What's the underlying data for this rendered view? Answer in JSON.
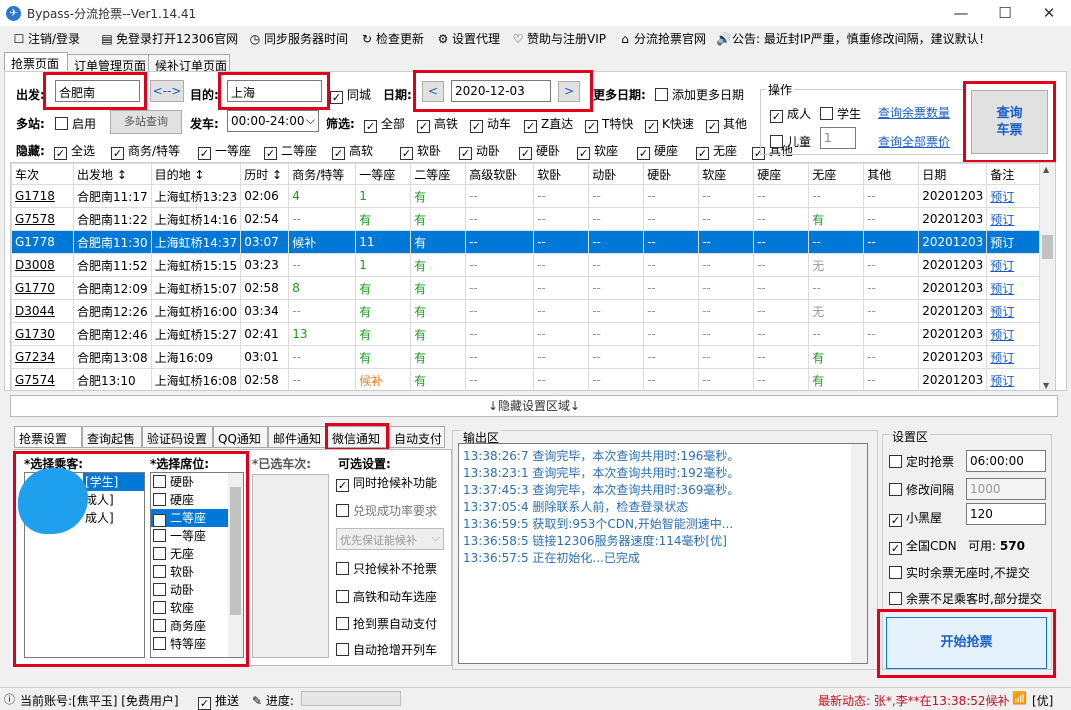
{
  "window": {
    "title": "Bypass-分流抢票--Ver1.14.41",
    "min": "—",
    "max": "☐",
    "close": "✕"
  },
  "menu": [
    {
      "icon": "☐",
      "label": "注销/登录"
    },
    {
      "icon": "▤",
      "label": "免登录打开12306官网"
    },
    {
      "icon": "◷",
      "label": "同步服务器时间"
    },
    {
      "icon": "↻",
      "label": "检查更新"
    },
    {
      "icon": "⚙",
      "label": "设置代理"
    },
    {
      "icon": "♡",
      "label": "赞助与注册VIP"
    },
    {
      "icon": "⌂",
      "label": "分流抢票官网"
    },
    {
      "icon": "🔊",
      "label": "公告: 最近封IP严重，慎重修改间隔，建议默认！"
    }
  ],
  "tabs": [
    "抢票页面",
    "订单管理页面",
    "候补订单页面"
  ],
  "query": {
    "from_label": "出发:",
    "from": "合肥南",
    "swap": "<-->",
    "to_label": "目的:",
    "to": "上海",
    "same_city": "同城",
    "date_label": "日期:",
    "date": "2020-12-03",
    "prev": "<",
    "next": ">",
    "more_dates_label": "更多日期:",
    "add_more_dates": "添加更多日期",
    "multi_label": "多站:",
    "enable": "启用",
    "multi_query": "多站查询",
    "depart_label": "发车:",
    "depart_time": "00:00-24:00",
    "filter_label": "筛选:",
    "filters": [
      {
        "label": "全部",
        "checked": true
      },
      {
        "label": "高铁",
        "checked": true
      },
      {
        "label": "动车",
        "checked": true
      },
      {
        "label": "Z直达",
        "checked": true
      },
      {
        "label": "T特快",
        "checked": true
      },
      {
        "label": "K快速",
        "checked": true
      },
      {
        "label": "其他",
        "checked": true
      }
    ],
    "hide_label": "隐藏:",
    "hides": [
      {
        "label": "全选",
        "checked": true
      },
      {
        "label": "商务/特等",
        "checked": true
      },
      {
        "label": "一等座",
        "checked": true
      },
      {
        "label": "二等座",
        "checked": true
      },
      {
        "label": "高软",
        "checked": true
      },
      {
        "label": "软卧",
        "checked": true
      },
      {
        "label": "动卧",
        "checked": true
      },
      {
        "label": "硬卧",
        "checked": true
      },
      {
        "label": "软座",
        "checked": true
      },
      {
        "label": "硬座",
        "checked": true
      },
      {
        "label": "无座",
        "checked": true
      },
      {
        "label": "其他",
        "checked": true
      }
    ]
  },
  "ops": {
    "title": "操作",
    "adult": "成人",
    "student": "学生",
    "child": "儿童",
    "child_count": "1",
    "query_remain": "查询余票数量",
    "query_prices": "查询全部票价",
    "query_btn": "查询\n车票"
  },
  "table": {
    "headers": [
      "车次",
      "出发地 ↕",
      "目的地 ↕",
      "历时 ↕",
      "商务/特等",
      "一等座",
      "二等座",
      "高级软卧",
      "软卧",
      "动卧",
      "硬卧",
      "软座",
      "硬座",
      "无座",
      "其他",
      "日期",
      "备注"
    ],
    "rows": [
      [
        "G1718",
        "合肥南11:17",
        "上海虹桥13:23",
        "02:06",
        "4",
        "1",
        "有",
        "--",
        "--",
        "--",
        "--",
        "--",
        "--",
        "--",
        "--",
        "20201203",
        "预订"
      ],
      [
        "G7578",
        "合肥南11:22",
        "上海虹桥14:16",
        "02:54",
        "--",
        "有",
        "有",
        "--",
        "--",
        "--",
        "--",
        "--",
        "--",
        "有",
        "--",
        "20201203",
        "预订"
      ],
      [
        "G1778",
        "合肥南11:30",
        "上海虹桥14:37",
        "03:07",
        "候补",
        "11",
        "有",
        "--",
        "--",
        "--",
        "--",
        "--",
        "--",
        "--",
        "--",
        "20201203",
        "预订"
      ],
      [
        "D3008",
        "合肥南11:52",
        "上海虹桥15:15",
        "03:23",
        "--",
        "1",
        "有",
        "--",
        "--",
        "--",
        "--",
        "--",
        "--",
        "无",
        "--",
        "20201203",
        "预订"
      ],
      [
        "G1770",
        "合肥南12:09",
        "上海虹桥15:07",
        "02:58",
        "8",
        "有",
        "有",
        "--",
        "--",
        "--",
        "--",
        "--",
        "--",
        "--",
        "--",
        "20201203",
        "预订"
      ],
      [
        "D3044",
        "合肥南12:26",
        "上海虹桥16:00",
        "03:34",
        "--",
        "有",
        "有",
        "--",
        "--",
        "--",
        "--",
        "--",
        "--",
        "无",
        "--",
        "20201203",
        "预订"
      ],
      [
        "G1730",
        "合肥南12:46",
        "上海虹桥15:27",
        "02:41",
        "13",
        "有",
        "有",
        "--",
        "--",
        "--",
        "--",
        "--",
        "--",
        "--",
        "--",
        "20201203",
        "预订"
      ],
      [
        "G7234",
        "合肥南13:08",
        "上海16:09",
        "03:01",
        "--",
        "有",
        "有",
        "--",
        "--",
        "--",
        "--",
        "--",
        "--",
        "有",
        "--",
        "20201203",
        "预订"
      ],
      [
        "G7574",
        "合肥13:10",
        "上海虹桥16:08",
        "02:58",
        "--",
        "候补",
        "有",
        "--",
        "--",
        "--",
        "--",
        "--",
        "--",
        "有",
        "--",
        "20201203",
        "预订"
      ]
    ]
  },
  "hide_area": "↓隐藏设置区域↓",
  "tabs2": [
    "抢票设置",
    "查询起售",
    "验证码设置",
    "QQ通知",
    "邮件通知",
    "微信通知",
    "自动支付"
  ],
  "settings": {
    "passengers_label": "*选择乘客:",
    "passengers": [
      "[学生]",
      "成人]",
      "成人]"
    ],
    "seats_label": "*选择席位:",
    "seats": [
      {
        "label": "硬卧",
        "checked": false
      },
      {
        "label": "硬座",
        "checked": false
      },
      {
        "label": "二等座",
        "checked": true
      },
      {
        "label": "一等座",
        "checked": false
      },
      {
        "label": "无座",
        "checked": false
      },
      {
        "label": "软卧",
        "checked": false
      },
      {
        "label": "动卧",
        "checked": false
      },
      {
        "label": "软座",
        "checked": false
      },
      {
        "label": "商务座",
        "checked": false
      },
      {
        "label": "特等座",
        "checked": false
      }
    ],
    "trains_label": "*已选车次:",
    "options_label": "可选设置:",
    "options": [
      {
        "label": "同时抢候补功能",
        "checked": true
      },
      {
        "label": "兑现成功率要求",
        "checked": false
      },
      {
        "label": "只抢候补不抢票",
        "checked": false
      },
      {
        "label": "高铁和动车选座",
        "checked": false
      },
      {
        "label": "抢到票自动支付",
        "checked": false
      },
      {
        "label": "自动抢增开列车",
        "checked": false
      }
    ],
    "priority": "优先保证能候补"
  },
  "output": {
    "title": "输出区",
    "lines": [
      "13:38:26:7  查询完毕，本次查询共用时:196毫秒。",
      "13:38:23:1  查询完毕，本次查询共用时:192毫秒。",
      "13:37:45:3  查询完毕，本次查询共用时:369毫秒。",
      "13:37:05:4  删除联系人前，检查登录状态",
      "13:36:59:5  获取到:953个CDN,开始智能测速中...",
      "13:36:58:5  链接12306服务器速度:114毫秒[优]",
      "13:36:57:5  正在初始化...已完成"
    ]
  },
  "config": {
    "title": "设置区",
    "timed": "定时抢票",
    "timed_val": "06:00:00",
    "interval": "修改间隔",
    "interval_val": "1000",
    "blackroom": "小黑屋",
    "blackroom_val": "120",
    "cdn": "全国CDN",
    "cdn_avail": "可用:",
    "cdn_count": "570",
    "no_seat": "实时余票无座时,不提交",
    "partial": "余票不足乘客时,部分提交",
    "start": "开始抢票"
  },
  "status": {
    "account": "当前账号:[焦平玉] [免费用户]",
    "push": "推送",
    "progress": "进度:",
    "news": "最新动态: 张*,李**在13:38:52候补",
    "net": "[优]"
  },
  "colors": {
    "accent": "#0078d7",
    "highlight": "#e0001b",
    "green": "#1f9b1f",
    "orange": "#f08020"
  }
}
